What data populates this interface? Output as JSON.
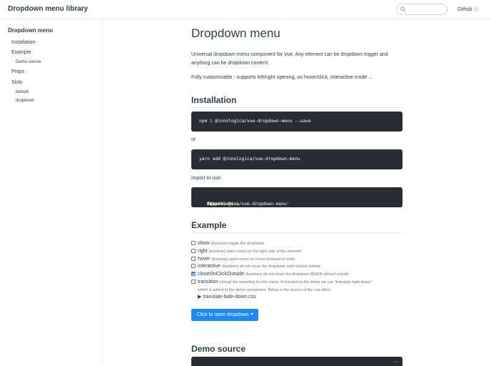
{
  "navbar": {
    "site_name": "Dropdown menu library",
    "search_placeholder": "",
    "github_label": "Github"
  },
  "sidebar": {
    "title": "Dropdown menu",
    "items": [
      {
        "label": "Installation"
      },
      {
        "label": "Example"
      },
      {
        "label": "Demo source"
      },
      {
        "label": "Props"
      },
      {
        "label": "Slots"
      },
      {
        "label": "default"
      },
      {
        "label": "dropdown"
      }
    ]
  },
  "main": {
    "title": "Dropdown menu",
    "intro_1": "Universal dropdown menu component for Vue. Any element can be dropdown trigger and anything can be dropdown content.",
    "intro_2": "Fully customizable - supports left/right opening, on hover/click, interactive mode ...",
    "installation_heading": "Installation",
    "install_npm": "npm i @innologica/vue-dropdown-menu --save",
    "or_text": "or",
    "install_yarn": "yarn add @innologica/vue-dropdown-menu",
    "import_label": "import to use:",
    "import_code": {
      "kw1": "import",
      "name": "DropdownMenu",
      "kw2": "from",
      "module": "'@innologica/vue-dropdown-menu'"
    },
    "example_heading": "Example",
    "options": [
      {
        "name": "show",
        "desc": "(boolean) toggle the dropdown",
        "checked": false
      },
      {
        "name": "right",
        "desc": "(boolean) open menu on the right side of the element",
        "checked": false
      },
      {
        "name": "hover",
        "desc": "(boolean) open menu on hover (instead of click)",
        "checked": false
      },
      {
        "name": "interactive",
        "desc": "(boolean) do not close the dropdown until clicked outside",
        "checked": false
      },
      {
        "name": "closeOnClickOutside",
        "desc": "(boolean) do not close the dropdown WHEN clicked outside",
        "checked": true
      },
      {
        "name": "transition",
        "desc": "(string) the transition for the menu. If checked in the demo we use \"translate-fade-down\"",
        "checked": false
      }
    ],
    "transition_desc_cont": "which is added in the demo component. Below is the source of the css effect.",
    "details_label": "translate-fade-down.css",
    "open_button": "Click to open dropdown",
    "demo_source_heading": "Demo source",
    "code_lang": "vue"
  }
}
